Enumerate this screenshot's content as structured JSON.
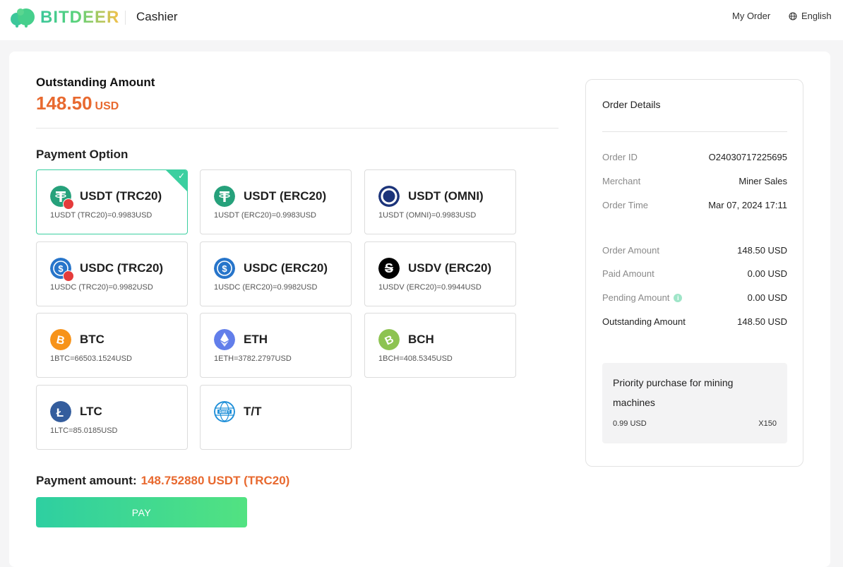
{
  "header": {
    "brand": "BITDEER",
    "title": "Cashier",
    "my_order": "My Order",
    "language": "English"
  },
  "main": {
    "outstanding_label": "Outstanding Amount",
    "outstanding_value": "148.50",
    "outstanding_currency": "USD",
    "payment_option_label": "Payment Option",
    "options": [
      {
        "name": "USDT (TRC20)",
        "rate": "1USDT (TRC20)=0.9983USD",
        "icon": "usdt-trc20-icon",
        "selected": true
      },
      {
        "name": "USDT (ERC20)",
        "rate": "1USDT (ERC20)=0.9983USD",
        "icon": "usdt-erc20-icon",
        "selected": false
      },
      {
        "name": "USDT (OMNI)",
        "rate": "1USDT (OMNI)=0.9983USD",
        "icon": "usdt-omni-icon",
        "selected": false
      },
      {
        "name": "USDC (TRC20)",
        "rate": "1USDC (TRC20)=0.9982USD",
        "icon": "usdc-trc20-icon",
        "selected": false
      },
      {
        "name": "USDC (ERC20)",
        "rate": "1USDC (ERC20)=0.9982USD",
        "icon": "usdc-erc20-icon",
        "selected": false
      },
      {
        "name": "USDV (ERC20)",
        "rate": "1USDV (ERC20)=0.9944USD",
        "icon": "usdv-erc20-icon",
        "selected": false
      },
      {
        "name": "BTC",
        "rate": "1BTC=66503.1524USD",
        "icon": "btc-icon",
        "selected": false
      },
      {
        "name": "ETH",
        "rate": "1ETH=3782.2797USD",
        "icon": "eth-icon",
        "selected": false
      },
      {
        "name": "BCH",
        "rate": "1BCH=408.5345USD",
        "icon": "bch-icon",
        "selected": false
      },
      {
        "name": "LTC",
        "rate": "1LTC=85.0185USD",
        "icon": "ltc-icon",
        "selected": false
      },
      {
        "name": "T/T",
        "rate": "",
        "icon": "swift-icon",
        "selected": false
      }
    ],
    "payment_amount_label": "Payment amount:",
    "payment_amount_value": "148.752880 USDT (TRC20)",
    "pay_button": "PAY"
  },
  "order": {
    "title": "Order Details",
    "rows": [
      {
        "key": "Order ID",
        "value": "O24030717225695"
      },
      {
        "key": "Merchant",
        "value": "Miner Sales"
      },
      {
        "key": "Order Time",
        "value": "Mar 07, 2024 17:11"
      },
      {
        "key": "Order Amount",
        "value": "148.50 USD"
      },
      {
        "key": "Paid Amount",
        "value": "0.00 USD"
      },
      {
        "key": "Pending Amount",
        "value": "0.00 USD"
      },
      {
        "key": "Outstanding Amount",
        "value": "148.50 USD"
      }
    ],
    "product": {
      "name": "Priority purchase for mining machines",
      "price": "0.99 USD",
      "qty": "X150"
    }
  },
  "colors": {
    "accent": "#e8692f",
    "brand_green": "#3ccfa0",
    "tether": "#26a17b",
    "usdc": "#2775ca",
    "btc": "#f7931a",
    "eth": "#627eea",
    "bch": "#8dc351",
    "ltc": "#345d9d"
  }
}
